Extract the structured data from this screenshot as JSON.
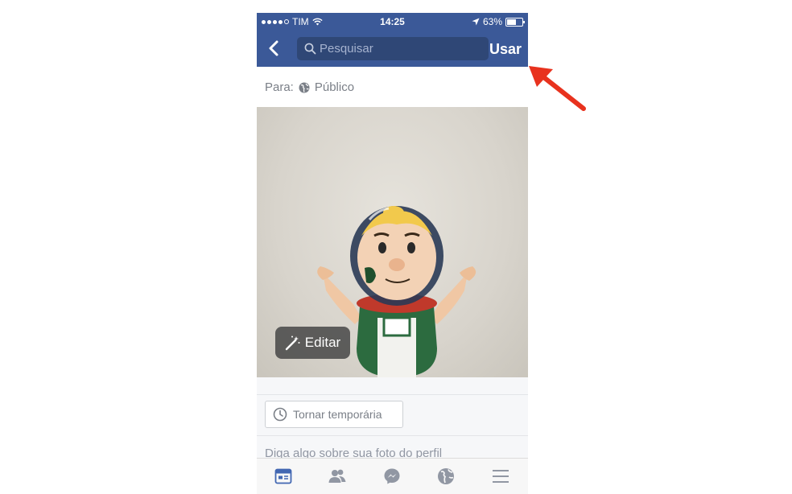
{
  "status_bar": {
    "carrier": "TIM",
    "time": "14:25",
    "battery": "63%",
    "battery_level": 0.63
  },
  "nav": {
    "search_placeholder": "Pesquisar",
    "use_label": "Usar"
  },
  "audience": {
    "label": "Para:",
    "value": "Público"
  },
  "photo": {
    "edit_label": "Editar"
  },
  "actions": {
    "temporary_label": "Tornar temporária"
  },
  "caption": {
    "placeholder": "Diga algo sobre sua foto do perfil"
  },
  "tabbar": {
    "items": [
      "news-feed-icon",
      "friends-icon",
      "messenger-icon",
      "globe-icon",
      "menu-icon"
    ],
    "active": "news-feed-icon"
  },
  "colors": {
    "brand": "#3b5998",
    "annotation_arrow": "#e8321e"
  }
}
